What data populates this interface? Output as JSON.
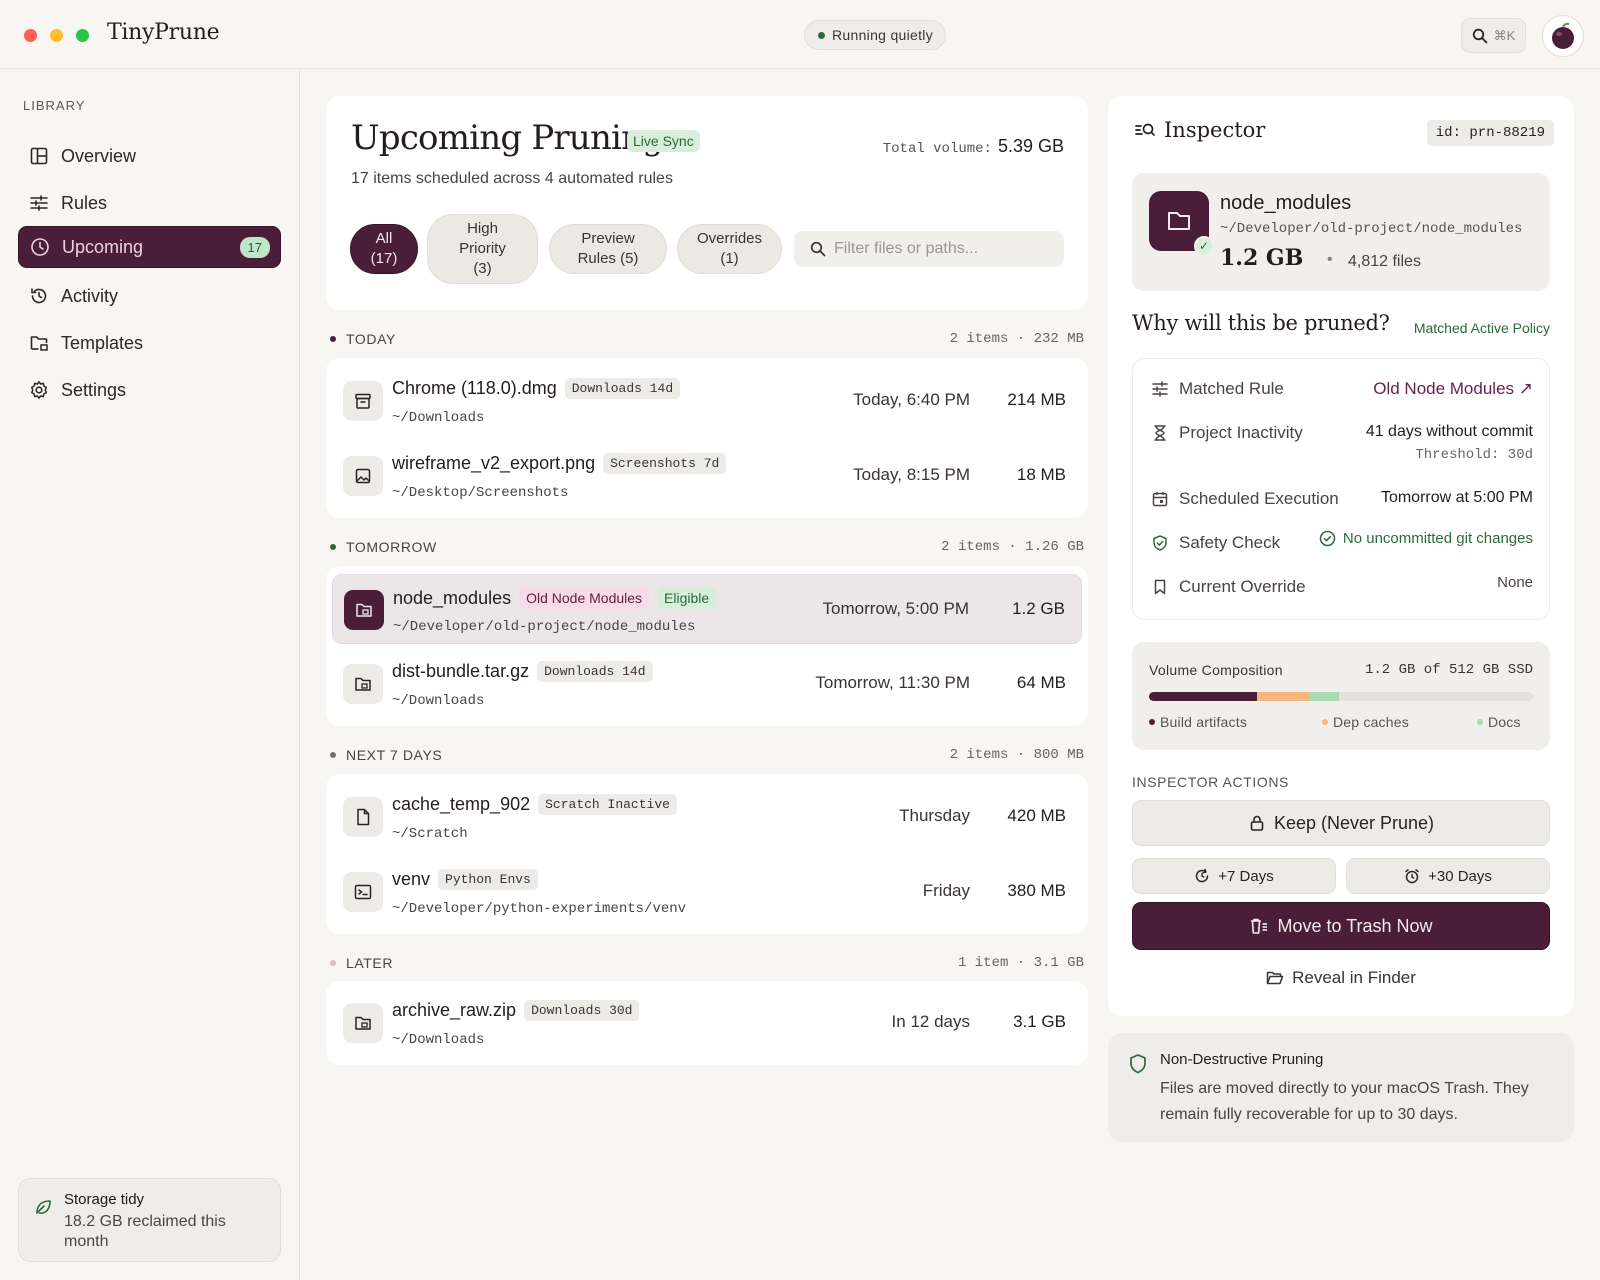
{
  "app": {
    "title": "TinyPrune",
    "status": "Running quietly",
    "search_shortcut": "⌘K"
  },
  "sidebar": {
    "section_label": "LIBRARY",
    "items": [
      {
        "label": "Overview",
        "icon": "layout-icon"
      },
      {
        "label": "Rules",
        "icon": "sliders-icon"
      },
      {
        "label": "Upcoming",
        "icon": "clock-icon",
        "badge": "17",
        "active": true
      },
      {
        "label": "Activity",
        "icon": "history-icon"
      },
      {
        "label": "Templates",
        "icon": "folder-template-icon"
      },
      {
        "label": "Settings",
        "icon": "gear-icon"
      }
    ],
    "storage": {
      "title": "Storage tidy",
      "subtitle": "18.2 GB reclaimed this month"
    }
  },
  "header": {
    "title": "Upcoming Pruning",
    "live_badge": "Live Sync",
    "total_label": "Total volume:",
    "total_value": "5.39 GB",
    "subtitle": "17 items scheduled across 4 automated rules",
    "tabs": [
      {
        "label": "All\n(17)",
        "active": true
      },
      {
        "label": "High\nPriority\n(3)"
      },
      {
        "label": "Preview\nRules (5)"
      },
      {
        "label": "Overrides\n(1)"
      }
    ],
    "filter_placeholder": "Filter files or paths..."
  },
  "groups": [
    {
      "label": "TODAY",
      "meta": "2 items · 232 MB",
      "rows": [
        {
          "name": "Chrome (118.0).dmg",
          "tag": "Downloads 14d",
          "path": "~/Downloads",
          "time": "Today, 6:40 PM",
          "size": "214 MB"
        },
        {
          "name": "wireframe_v2_export.png",
          "tag": "Screenshots 7d",
          "path": "~/Desktop/Screenshots",
          "time": "Today, 8:15 PM",
          "size": "18 MB"
        }
      ]
    },
    {
      "label": "TOMORROW",
      "meta": "2 items · 1.26 GB",
      "rows": [
        {
          "name": "node_modules",
          "tag": "Old Node Modules",
          "tag2": "Eligible",
          "path": "~/Developer/old-project/node_modules",
          "time": "Tomorrow, 5:00 PM",
          "size": "1.2 GB"
        },
        {
          "name": "dist-bundle.tar.gz",
          "tag": "Downloads 14d",
          "path": "~/Downloads",
          "time": "Tomorrow, 11:30 PM",
          "size": "64 MB"
        }
      ]
    },
    {
      "label": "NEXT 7 DAYS",
      "meta": "2 items · 800 MB",
      "rows": [
        {
          "name": "cache_temp_902",
          "tag": "Scratch Inactive",
          "path": "~/Scratch",
          "time": "Thursday",
          "size": "420 MB"
        },
        {
          "name": "venv",
          "tag": "Python Envs",
          "path": "~/Developer/python-experiments/venv",
          "time": "Friday",
          "size": "380 MB"
        }
      ]
    },
    {
      "label": "LATER",
      "meta": "1 item · 3.1 GB",
      "rows": [
        {
          "name": "archive_raw.zip",
          "tag": "Downloads 30d",
          "path": "~/Downloads",
          "time": "In 12 days",
          "size": "3.1 GB"
        }
      ]
    }
  ],
  "inspector": {
    "title": "Inspector",
    "id": "id: prn-88219",
    "file": {
      "name": "node_modules",
      "path": "~/Developer/old-project/node_modules",
      "size": "1.2 GB",
      "count": "4,812 files"
    },
    "why_title": "Why will this be pruned?",
    "policy": "Matched Active Policy",
    "details": {
      "rule_label": "Matched Rule",
      "rule_value": "Old Node Modules ↗",
      "inactivity_label": "Project Inactivity",
      "inactivity_value": "41 days without commit",
      "inactivity_threshold": "Threshold: 30d",
      "execution_label": "Scheduled Execution",
      "execution_value": "Tomorrow at 5:00 PM",
      "safety_label": "Safety Check",
      "safety_value": "No uncommitted git changes",
      "override_label": "Current Override",
      "override_value": "None"
    },
    "composition": {
      "title": "Volume Composition",
      "total": "1.2 GB of 512 GB SSD",
      "segments": [
        {
          "name": "Build artifacts",
          "fraction": 0.28,
          "color": "#4a1e39"
        },
        {
          "name": "Dep caches",
          "fraction": 0.14,
          "color": "#f6b77f"
        },
        {
          "name": "Docs",
          "fraction": 0.075,
          "color": "#a9dab3"
        }
      ]
    },
    "actions_label": "INSPECTOR ACTIONS",
    "keep": "Keep (Never Prune)",
    "plus7": "+7 Days",
    "plus30": "+30 Days",
    "trash": "Move to Trash Now",
    "reveal": "Reveal in Finder"
  },
  "note": {
    "title": "Non-Destructive Pruning",
    "body": "Files are moved directly to your macOS Trash. They remain fully recoverable for up to 30 days."
  },
  "colors": {
    "accent": "#4a1e39",
    "success": "#2b6a3c",
    "live_bg": "#d7eedb"
  }
}
